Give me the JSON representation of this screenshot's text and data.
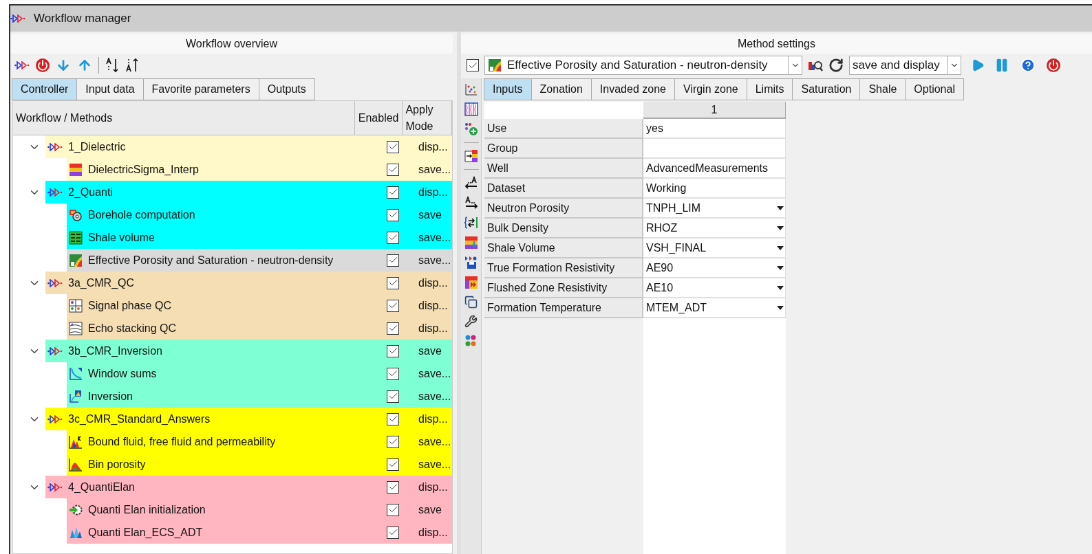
{
  "window": {
    "title": "Workflow manager"
  },
  "overview": {
    "title": "Workflow overview",
    "tabs": [
      {
        "label": "Controller",
        "selected": true
      },
      {
        "label": "Input data",
        "selected": false
      },
      {
        "label": "Favorite parameters",
        "selected": false
      },
      {
        "label": "Outputs",
        "selected": false
      }
    ],
    "columns": [
      "Workflow / Methods",
      "Enabled",
      "Apply Mode"
    ],
    "groups": [
      {
        "name": "1_Dielectric",
        "color": "#fff8c8",
        "expanded": true,
        "enabled": true,
        "mode": "disp...",
        "selected": false,
        "children": [
          {
            "name": "DielectricSigma_Interp",
            "kind": "bands",
            "enabled": true,
            "mode": "save...",
            "selected": false
          }
        ]
      },
      {
        "name": "2_Quanti",
        "color": "#00ffff",
        "expanded": true,
        "enabled": true,
        "mode": "disp...",
        "selected": false,
        "children": [
          {
            "name": "Borehole computation",
            "kind": "gear",
            "enabled": true,
            "mode": "save",
            "selected": false
          },
          {
            "name": "Shale volume",
            "kind": "lines",
            "enabled": true,
            "mode": "save...",
            "selected": false
          },
          {
            "name": "Effective Porosity and Saturation - neutron-density",
            "kind": "chart",
            "enabled": true,
            "mode": "save...",
            "selected": true
          }
        ]
      },
      {
        "name": "3a_CMR_QC",
        "color": "#f5deb3",
        "expanded": true,
        "enabled": true,
        "mode": "disp...",
        "selected": false,
        "children": [
          {
            "name": "Signal phase QC",
            "kind": "grid",
            "enabled": true,
            "mode": "disp...",
            "selected": false
          },
          {
            "name": "Echo stacking QC",
            "kind": "stack",
            "enabled": true,
            "mode": "disp...",
            "selected": false
          }
        ]
      },
      {
        "name": "3b_CMR_Inversion",
        "color": "#7fffd4",
        "expanded": true,
        "enabled": true,
        "mode": "save",
        "selected": false,
        "children": [
          {
            "name": "Window sums",
            "kind": "curve",
            "enabled": true,
            "mode": "save...",
            "selected": false
          },
          {
            "name": "Inversion",
            "kind": "inversion",
            "enabled": true,
            "mode": "save...",
            "selected": false
          }
        ]
      },
      {
        "name": "3c_CMR_Standard_Answers",
        "color": "#ffff00",
        "expanded": true,
        "enabled": true,
        "mode": "disp...",
        "selected": false,
        "children": [
          {
            "name": "Bound fluid, free fluid and permeability",
            "kind": "peaks",
            "enabled": true,
            "mode": "save...",
            "selected": false
          },
          {
            "name": "Bin porosity",
            "kind": "histogram",
            "enabled": true,
            "mode": "save...",
            "selected": false
          }
        ]
      },
      {
        "name": "4_QuantiElan",
        "color": "#ffb6c1",
        "expanded": true,
        "enabled": true,
        "mode": "disp...",
        "selected": false,
        "children": [
          {
            "name": "Quanti Elan initialization",
            "kind": "arrow-gear",
            "enabled": true,
            "mode": "save",
            "selected": false
          },
          {
            "name": "Quanti Elan_ECS_ADT",
            "kind": "crystal",
            "enabled": true,
            "mode": "disp...",
            "selected": false
          }
        ]
      }
    ]
  },
  "settings": {
    "title": "Method settings",
    "enabled": true,
    "method": "Effective Porosity and Saturation - neutron-density",
    "mode": "save and display",
    "tabs": [
      {
        "label": "Inputs",
        "selected": true
      },
      {
        "label": "Zonation",
        "selected": false
      },
      {
        "label": "Invaded zone",
        "selected": false
      },
      {
        "label": "Virgin zone",
        "selected": false
      },
      {
        "label": "Limits",
        "selected": false
      },
      {
        "label": "Saturation",
        "selected": false
      },
      {
        "label": "Shale",
        "selected": false
      },
      {
        "label": "Optional",
        "selected": false
      }
    ],
    "column": "1",
    "rows": [
      {
        "label": "Use",
        "value": "yes",
        "dropdown": false
      },
      {
        "label": "Group",
        "dropdown": false
      },
      {
        "label": "Well",
        "value": "AdvancedMeasurements",
        "dropdown": false
      },
      {
        "label": "Dataset",
        "value": "Working",
        "dropdown": false
      },
      {
        "label": "Neutron Porosity",
        "value": "TNPH_LIM",
        "dropdown": true
      },
      {
        "label": "Bulk Density",
        "value": "RHOZ",
        "dropdown": true
      },
      {
        "label": "Shale Volume",
        "value": "VSH_FINAL",
        "dropdown": true
      },
      {
        "label": "True Formation Resistivity",
        "value": "AE90",
        "dropdown": true
      },
      {
        "label": "Flushed Zone Resistivity",
        "value": "AE10",
        "dropdown": true
      },
      {
        "label": "Formation Temperature",
        "value": "MTEM_ADT",
        "dropdown": true
      }
    ]
  }
}
